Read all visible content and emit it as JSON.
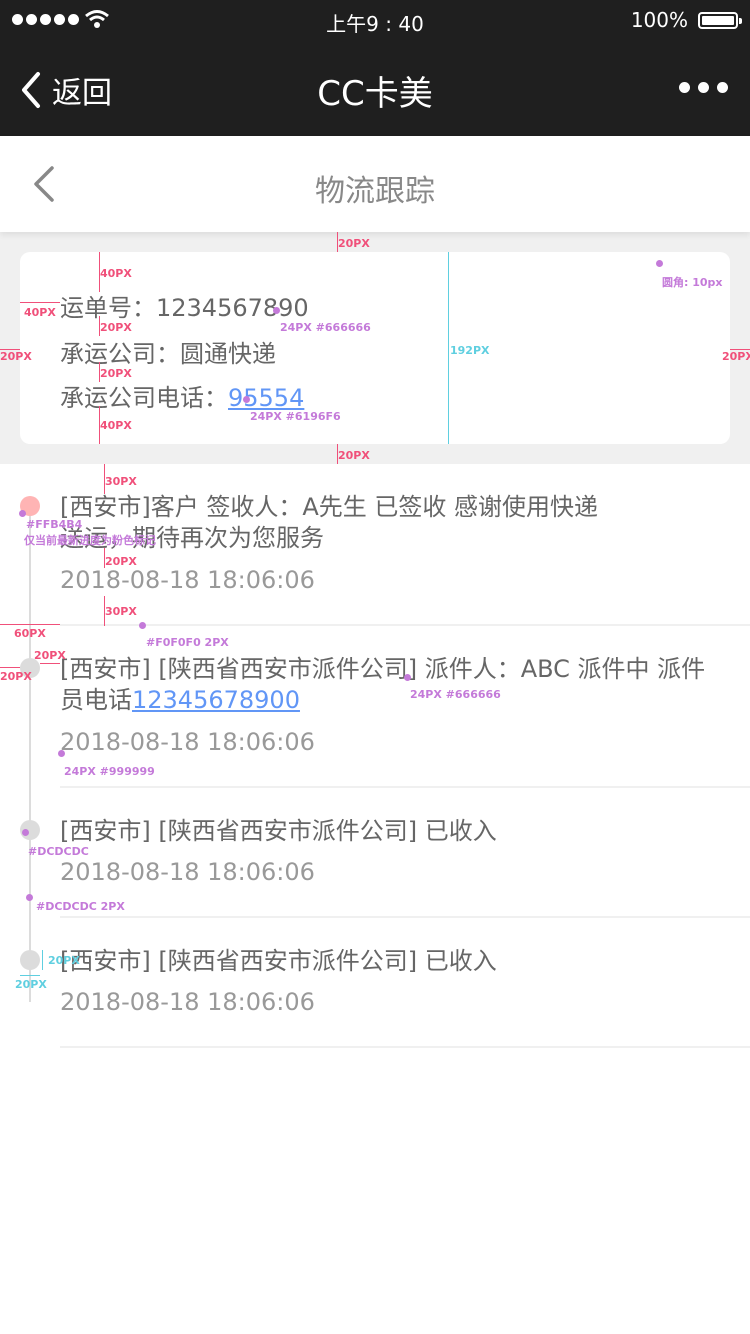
{
  "status_bar": {
    "time": "上午9 : 40",
    "battery": "100%"
  },
  "wx_nav": {
    "back_label": "返回",
    "title": "CC卡美"
  },
  "page": {
    "title": "物流跟踪"
  },
  "waybill": {
    "number_label": "运单号：",
    "number": "1234567890",
    "carrier_label": "承运公司：",
    "carrier": "圆通快递",
    "phone_label": "承运公司电话：",
    "phone": "95554"
  },
  "timeline": {
    "items": [
      {
        "text": "[西安市]客户 签收人：A先生 已签收 感谢使用快递",
        "text2": "送运，期待再次为您服务",
        "time": "2018-08-18 18:06:06"
      },
      {
        "text": "[西安市] [陕西省西安市派件公司] 派件人：ABC 派件中 派件员电话",
        "phone": "12345678900",
        "time": "2018-08-18 18:06:06"
      },
      {
        "text": "[西安市] [陕西省西安市派件公司] 已收入",
        "time": "2018-08-18 18:06:06"
      },
      {
        "text": "[西安市] [陕西省西安市派件公司] 已收入",
        "time": "2018-08-18 18:06:06"
      }
    ]
  },
  "annotations": {
    "top_gap": "20PX",
    "bottom_gap": "20PX",
    "left_gap": "20PX",
    "right_gap": "20PX",
    "inner_left": "40PX",
    "inner_top": "40PX",
    "inner_bottom": "40PX",
    "line_gap_1": "20PX",
    "line_gap_2": "20PX",
    "card_height": "192PX",
    "radius": "圆角: 10px",
    "text_spec": "24PX #666666",
    "link_spec": "24PX #6196F6",
    "tl_top": "30PX",
    "current_color": "#FFB4B4",
    "current_note": "仅当前最新进度为粉色标记",
    "tl_text_gap": "20PX",
    "tl_bottom": "30PX",
    "tl_indent": "60PX",
    "sep_spec": "#F0F0F0 2PX",
    "dot_left": "20PX",
    "dot_right": "20PX",
    "item_text_spec": "24PX #666666",
    "time_spec": "24PX #999999",
    "dot_color": "#DCDCDC",
    "line_spec": "#DCDCDC 2PX",
    "dot_size_w": "20PX",
    "dot_size_h": "20PX"
  },
  "colors": {
    "nav_bg": "#1F1F1F",
    "text": "#666666",
    "link": "#6196F6",
    "time": "#999999",
    "current_dot": "#FFB4B4",
    "dot": "#DCDCDC",
    "separator": "#F0F0F0",
    "page_bg": "#F0F0F0"
  }
}
